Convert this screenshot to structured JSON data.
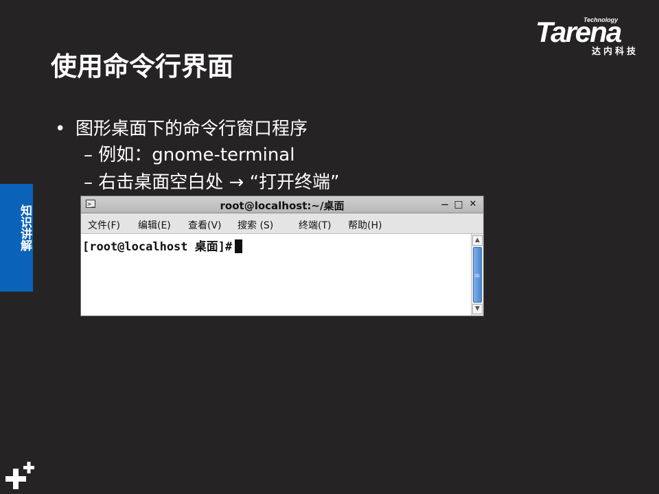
{
  "logo": {
    "technology": "Technology",
    "word": "Tarena",
    "chinese": "达内科技"
  },
  "slide": {
    "title": "使用命令行界面",
    "side_tab": "知识讲解",
    "bullet": "图形桌面下的命令行窗口程序",
    "sub1": "– 例如：gnome-terminal",
    "sub2": "– 右击桌面空白处 → “打开终端”"
  },
  "terminal": {
    "window_title": "root@localhost:~/桌面",
    "menu": [
      "文件(F)",
      "编辑(E)",
      "查看(V)",
      "搜索 (S)",
      "终端(T)",
      "帮助(H)"
    ],
    "prompt": "[root@localhost 桌面]#",
    "minimize": "−",
    "maximize": "□",
    "close": "✕"
  },
  "colors": {
    "background": "#262324",
    "side_tab": "#0a63b8",
    "scroll_thumb": "#4a86d3"
  }
}
